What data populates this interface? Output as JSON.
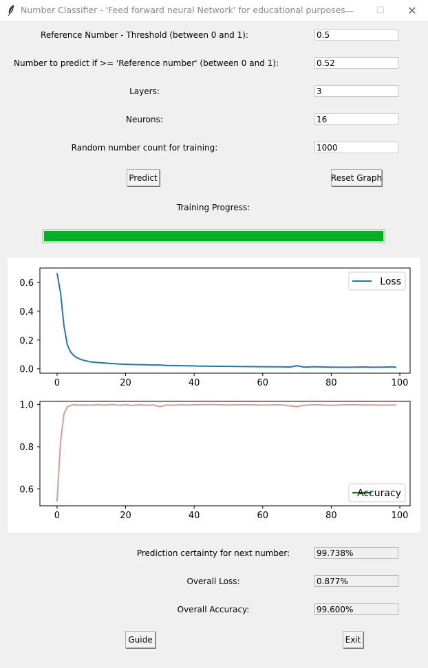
{
  "window": {
    "title": "Number Classifier - 'Feed forward neural Network' for educational purposes",
    "minimize_symbol": "—",
    "maximize_symbol": "☐",
    "close_symbol": "✕"
  },
  "form": {
    "threshold_label": "Reference Number - Threshold (between 0 and 1):",
    "threshold_value": "0.5",
    "predict_number_label": "Number to predict if >= 'Reference number' (between 0 and 1):",
    "predict_number_value": "0.52",
    "layers_label": "Layers:",
    "layers_value": "3",
    "neurons_label": "Neurons:",
    "neurons_value": "16",
    "random_count_label": "Random number count for training:",
    "random_count_value": "1000"
  },
  "buttons": {
    "predict": "Predict",
    "reset_graph": "Reset Graph",
    "guide": "Guide",
    "exit": "Exit"
  },
  "progress": {
    "label": "Training Progress:",
    "fraction": 1.0,
    "color": "#06b025"
  },
  "results": {
    "certainty_label": "Prediction certainty for next number:",
    "certainty_value": "99.738%",
    "loss_label": "Overall Loss:",
    "loss_value": "0.877%",
    "accuracy_label": "Overall Accuracy:",
    "accuracy_value": "99.600%"
  },
  "chart_data": [
    {
      "type": "line",
      "series": [
        {
          "name": "Loss",
          "color": "#1f77b4",
          "x": [
            0,
            1,
            2,
            3,
            4,
            5,
            6,
            7,
            8,
            9,
            10,
            12,
            14,
            16,
            18,
            20,
            22,
            24,
            26,
            28,
            30,
            32,
            34,
            36,
            38,
            40,
            42,
            45,
            50,
            55,
            60,
            65,
            68,
            70,
            72,
            75,
            80,
            85,
            90,
            92,
            95,
            98,
            99
          ],
          "y": [
            0.665,
            0.53,
            0.3,
            0.165,
            0.115,
            0.09,
            0.075,
            0.065,
            0.058,
            0.053,
            0.048,
            0.044,
            0.04,
            0.037,
            0.034,
            0.032,
            0.03,
            0.029,
            0.028,
            0.027,
            0.027,
            0.024,
            0.023,
            0.022,
            0.021,
            0.02,
            0.019,
            0.018,
            0.017,
            0.016,
            0.015,
            0.014,
            0.013,
            0.022,
            0.012,
            0.015,
            0.012,
            0.011,
            0.013,
            0.011,
            0.012,
            0.014,
            0.01
          ]
        }
      ],
      "xticks": [
        0,
        20,
        40,
        60,
        80,
        100
      ],
      "yticks": [
        0.0,
        0.2,
        0.4,
        0.6
      ],
      "ytick_labels": [
        "0.0",
        "0.2",
        "0.4",
        "0.6"
      ],
      "xlim": [
        -5,
        103
      ],
      "ylim": [
        -0.03,
        0.7
      ],
      "legend": "upper right",
      "grid": false
    },
    {
      "type": "line",
      "series": [
        {
          "name": "Accuracy",
          "legend_color": "#008000",
          "color": "#d4a090",
          "x": [
            0,
            1,
            2,
            3,
            4,
            5,
            6,
            8,
            10,
            12,
            14,
            16,
            18,
            20,
            22,
            24,
            26,
            28,
            30,
            32,
            34,
            36,
            38,
            40,
            45,
            50,
            55,
            60,
            65,
            70,
            72,
            75,
            80,
            85,
            90,
            95,
            99
          ],
          "y": [
            0.54,
            0.82,
            0.955,
            0.99,
            0.995,
            1.0,
            0.997,
            0.998,
            0.997,
            0.999,
            0.997,
            1.0,
            0.996,
            0.999,
            0.995,
            0.999,
            0.996,
            0.998,
            0.99,
            0.998,
            0.996,
            0.999,
            0.997,
            0.999,
            1.0,
            0.998,
            0.999,
            0.997,
            0.999,
            0.99,
            0.996,
            0.999,
            0.996,
            0.999,
            0.998,
            0.997,
            0.998
          ]
        }
      ],
      "xticks": [
        0,
        20,
        40,
        60,
        80,
        100
      ],
      "yticks": [
        0.6,
        0.8,
        1.0
      ],
      "ytick_labels": [
        "0.6",
        "0.8",
        "1.0"
      ],
      "xlim": [
        -5,
        103
      ],
      "ylim": [
        0.52,
        1.015
      ],
      "legend": "lower right",
      "grid": false
    }
  ]
}
